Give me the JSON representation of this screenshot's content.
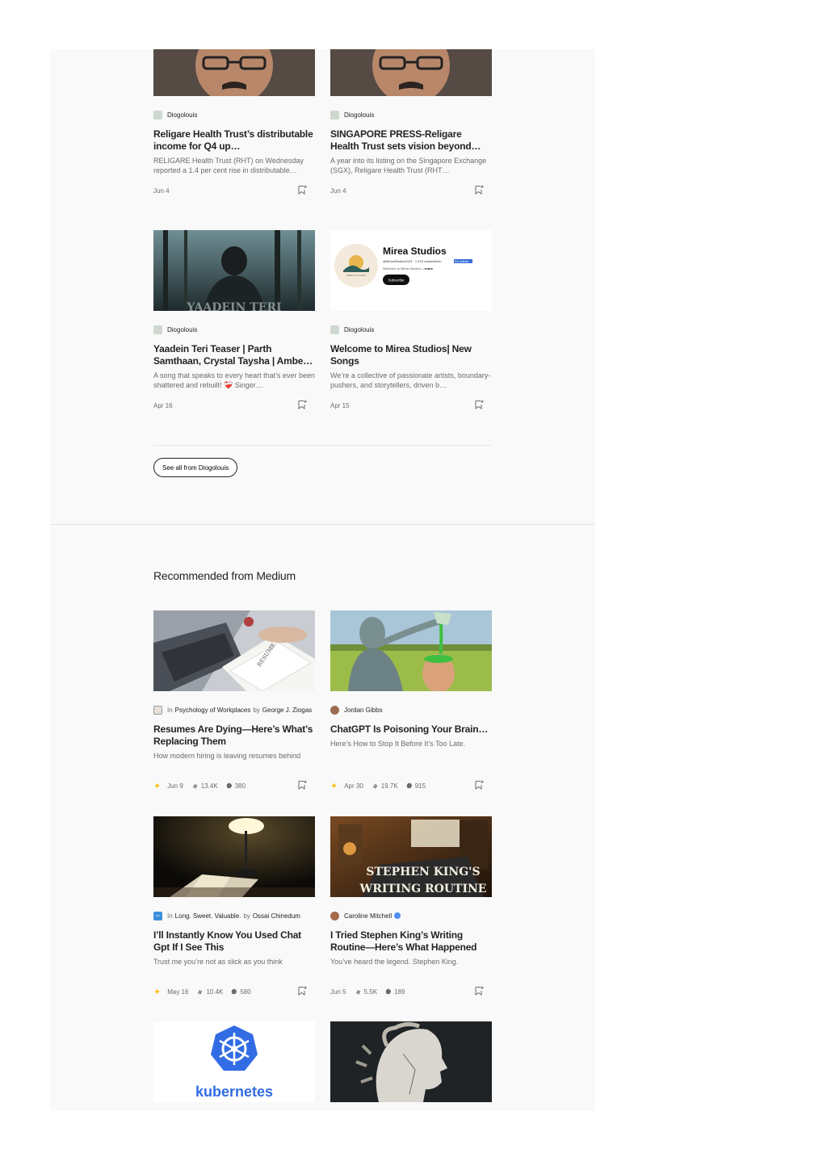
{
  "more_from": {
    "cards": [
      {
        "author": "Diogolouis",
        "title": "Religare Health Trust’s distributable income for Q4 up…",
        "subtitle": "RELIGARE Health Trust (RHT) on Wednesday reported a 1.4 per cent rise in distributable…",
        "date": "Jun 4"
      },
      {
        "author": "Diogolouis",
        "title": "SINGAPORE PRESS-Religare Health Trust sets vision beyond…",
        "subtitle": "A year into its listing on the Singapore Exchange (SGX), Religare Health Trust (RHT…",
        "date": "Jun 4"
      },
      {
        "author": "Diogolouis",
        "title": "Yaadein Teri Teaser | Parth Samthaan, Crystal Taysha | Ambe…",
        "subtitle": "A song that speaks to every heart that’s ever been shattered and rebuilt! ❤️‍🩹 Singer…",
        "date": "Apr 16",
        "thumb_text": "YAADEIN TERI"
      },
      {
        "author": "Diogolouis",
        "title": "Welcome to Mirea Studios| New Songs",
        "subtitle": "We’re a collective of passionate artists, boundary-pushers, and storytellers, driven b…",
        "date": "Apr 15"
      }
    ],
    "mirea_thumb": {
      "name": "Mirea Studios",
      "handle": "@MireaStudios2024 · 1.47K subscribers · ",
      "videos": "31 videos",
      "desc": "Welcome to Mirea Studios! ",
      "more": "...more",
      "subscribe": "Subscribe",
      "logo_text": "MIREA STUDIOS"
    },
    "see_all_label": "See all from Diogolouis"
  },
  "recommended": {
    "heading": "Recommended from Medium",
    "in_label": "In",
    "by_label": "by",
    "cards": [
      {
        "publication": "Psychology of Workplaces",
        "author": "George J. Ziogas",
        "title": "Resumes Are Dying—Here’s What’s Replacing Them",
        "subtitle": "How modern hiring is leaving resumes behind",
        "date": "Jun 9",
        "claps": "13.4K",
        "comments": "380",
        "member": true,
        "thumb_text": "RESUME"
      },
      {
        "author": "Jordan Gibbs",
        "title": "ChatGPT Is Poisoning Your Brain…",
        "subtitle": "Here’s How to Stop It Before It’s Too Late.",
        "date": "Apr 30",
        "claps": "19.7K",
        "comments": "915",
        "member": true
      },
      {
        "publication": "Long. Sweet. Valuable.",
        "author": "Ossai Chinedum",
        "title": "I’ll Instantly Know You Used Chat Gpt If I See This",
        "subtitle": "Trust me you’re not as slick as you think",
        "date": "May 16",
        "claps": "10.4K",
        "comments": "580",
        "member": true,
        "pub_logo_text": "LSV"
      },
      {
        "author": "Caroline Mitchell",
        "title": "I Tried Stephen King’s Writing Routine—Here’s What Happened",
        "subtitle": "You’ve heard the legend. Stephen King.",
        "date": "Jun 5",
        "claps": "5.5K",
        "comments": "189",
        "member": false,
        "verified": true,
        "thumb_text_1": "STEPHEN KING'S",
        "thumb_text_2": "WRITING ROUTINE"
      }
    ],
    "bottom_thumbs": [
      {
        "thumb_text": "kubernetes"
      },
      {}
    ]
  },
  "colors": {
    "accent_star": "#ffc017",
    "kubernetes_blue": "#326ce5",
    "verified_blue": "#4f8ef7"
  }
}
